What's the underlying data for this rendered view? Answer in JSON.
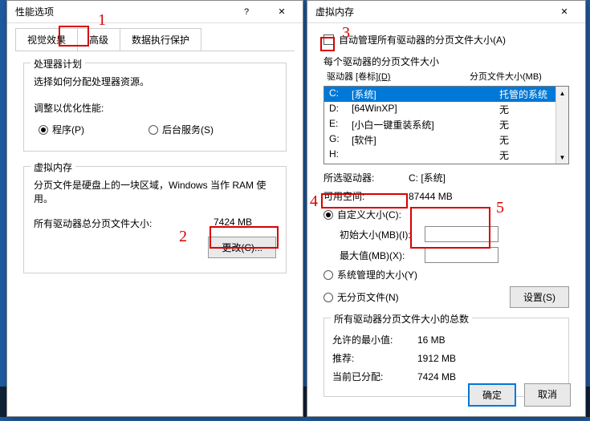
{
  "left_window": {
    "title": "性能选项",
    "tabs": {
      "visual": "视觉效果",
      "advanced": "高级",
      "dep": "数据执行保护"
    },
    "sched": {
      "group": "处理器计划",
      "desc": "选择如何分配处理器资源。",
      "adjust": "调整以优化性能:",
      "program": "程序(P)",
      "bgservice": "后台服务(S)"
    },
    "vm": {
      "group": "虚拟内存",
      "desc": "分页文件是硬盘上的一块区域，Windows 当作 RAM 使用。",
      "total_label": "所有驱动器总分页文件大小:",
      "total_value": "7424 MB",
      "change_btn": "更改(C)..."
    }
  },
  "right_window": {
    "title": "虚拟内存",
    "auto_manage": "自动管理所有驱动器的分页文件大小(A)",
    "each_drive": "每个驱动器的分页文件大小",
    "col_drive": "驱动器 [卷标]",
    "col_drive_key": "(D)",
    "col_page": "分页文件大小(MB)",
    "drives": [
      {
        "letter": "C:",
        "label": "[系统]",
        "page": "托管的系统",
        "selected": true
      },
      {
        "letter": "D:",
        "label": "[64WinXP]",
        "page": "无",
        "selected": false
      },
      {
        "letter": "E:",
        "label": "[小白一键重装系统]",
        "page": "无",
        "selected": false
      },
      {
        "letter": "G:",
        "label": "[软件]",
        "page": "无",
        "selected": false
      },
      {
        "letter": "H:",
        "label": "",
        "page": "无",
        "selected": false
      }
    ],
    "selected_drive_label": "所选驱动器:",
    "selected_drive_value": "C: [系统]",
    "free_space_label": "可用空间:",
    "free_space_value": "87444 MB",
    "custom_size": "自定义大小(C):",
    "initial_label": "初始大小(MB)(I):",
    "max_label": "最大值(MB)(X):",
    "system_managed": "系统管理的大小(Y)",
    "no_paging": "无分页文件(N)",
    "set_btn": "设置(S)",
    "totals": {
      "header": "所有驱动器分页文件大小的总数",
      "min_label": "允许的最小值:",
      "min_value": "16 MB",
      "rec_label": "推荐:",
      "rec_value": "1912 MB",
      "cur_label": "当前已分配:",
      "cur_value": "7424 MB"
    },
    "ok": "确定",
    "cancel": "取消"
  },
  "annotations": {
    "n1": "1",
    "n2": "2",
    "n3": "3",
    "n4": "4",
    "n5": "5"
  },
  "icons": {
    "close": "✕",
    "help": "?",
    "up": "▲",
    "down": "▼"
  }
}
